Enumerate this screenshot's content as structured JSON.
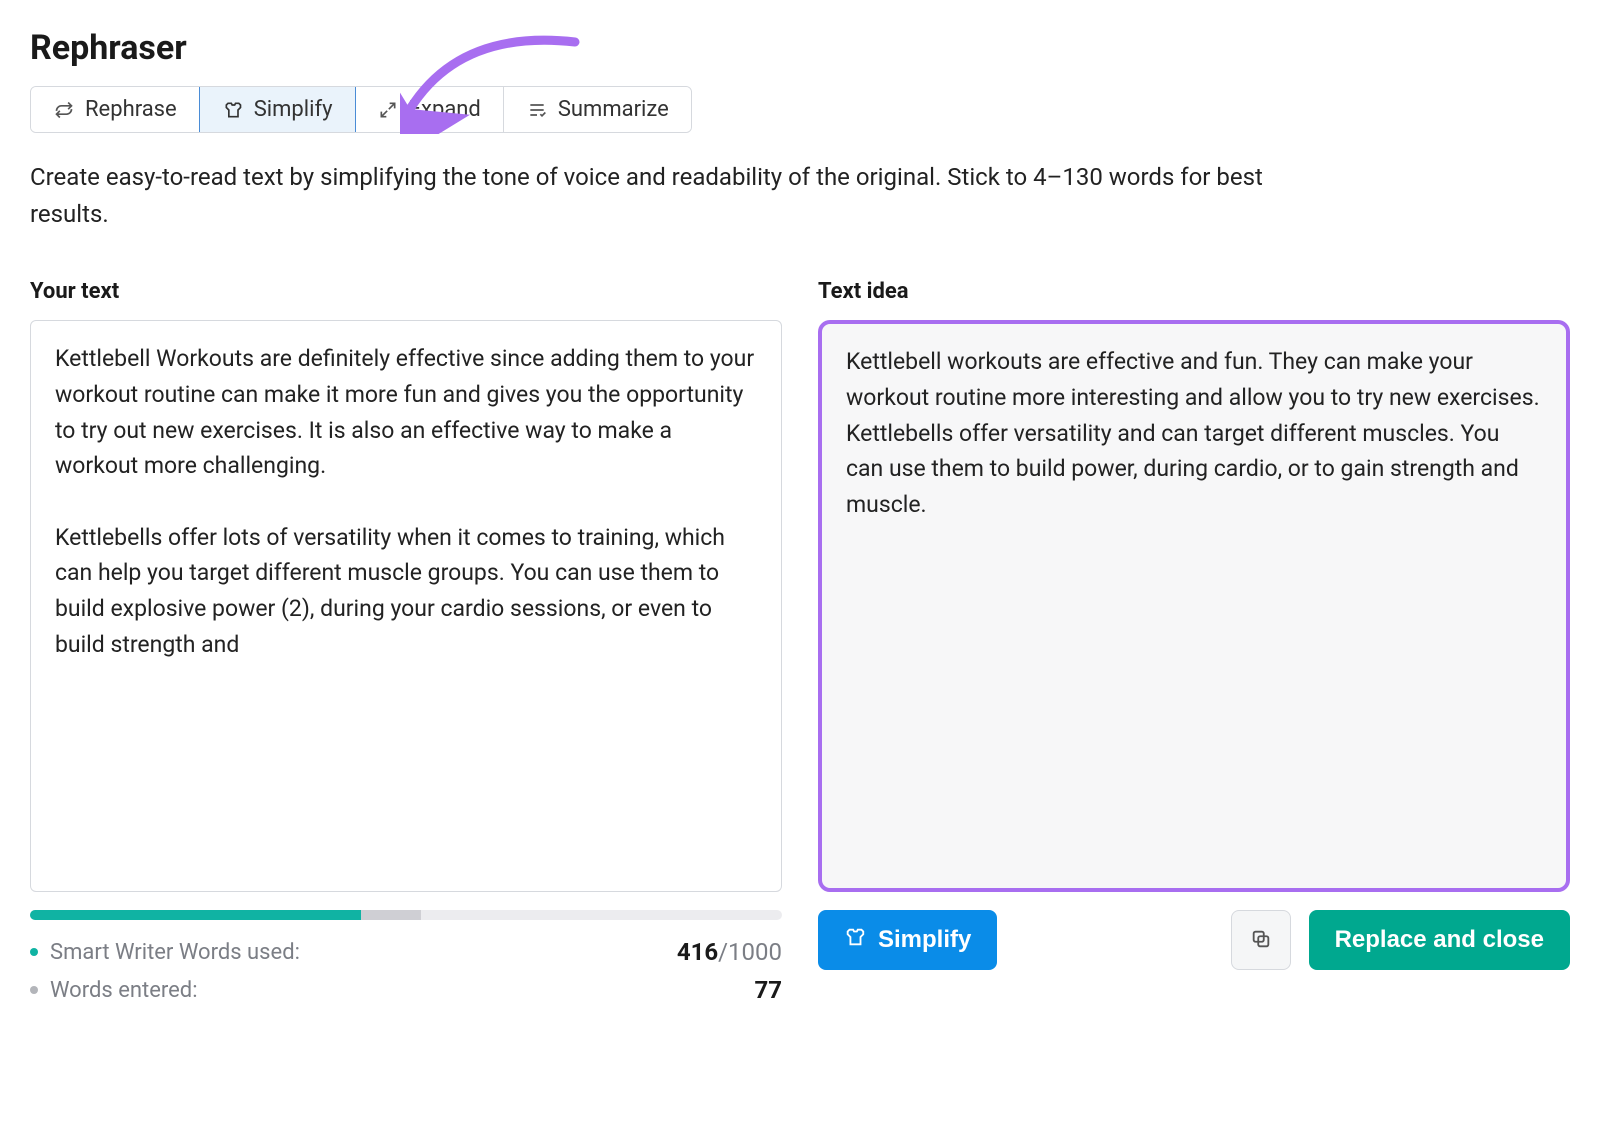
{
  "title": "Rephraser",
  "tabs": [
    {
      "id": "rephrase",
      "label": "Rephrase",
      "icon": "rephrase-icon",
      "active": false
    },
    {
      "id": "simplify",
      "label": "Simplify",
      "icon": "simplify-icon",
      "active": true
    },
    {
      "id": "expand",
      "label": "Expand",
      "icon": "expand-icon",
      "active": false
    },
    {
      "id": "summarize",
      "label": "Summarize",
      "icon": "summarize-icon",
      "active": false
    }
  ],
  "description": "Create easy-to-read text by simplifying the tone of voice and readability of the original. Stick to 4–130 words for best results.",
  "columns": {
    "input_label": "Your text",
    "output_label": "Text idea",
    "input_text": "Kettlebell Workouts are definitely effective since adding them to your workout routine can make it more fun and gives you the opportunity to try out new exercises. It is also an effective way to make a workout more challenging.\n\nKettlebells offer lots of versatility when it comes to training, which can help you target different muscle groups. You can use them to build explosive power (2), during your cardio sessions, or even to build strength and",
    "output_text": "Kettlebell workouts are effective and fun. They can make your workout routine more interesting and allow you to try new exercises. Kettlebells offer versatility and can target different muscles. You can use them to build power, during cardio, or to gain strength and muscle."
  },
  "stats": {
    "smart_writer_label": "Smart Writer Words used:",
    "smart_writer_used": "416",
    "smart_writer_total": "/1000",
    "words_entered_label": "Words entered:",
    "words_entered": "77",
    "progress_percent": 44
  },
  "actions": {
    "simplify_label": "Simplify",
    "replace_label": "Replace and close"
  },
  "colors": {
    "accent_blue": "#0a8ce8",
    "accent_green": "#00a88f",
    "highlight_purple": "#a86ef0",
    "teal": "#10b3a3"
  }
}
